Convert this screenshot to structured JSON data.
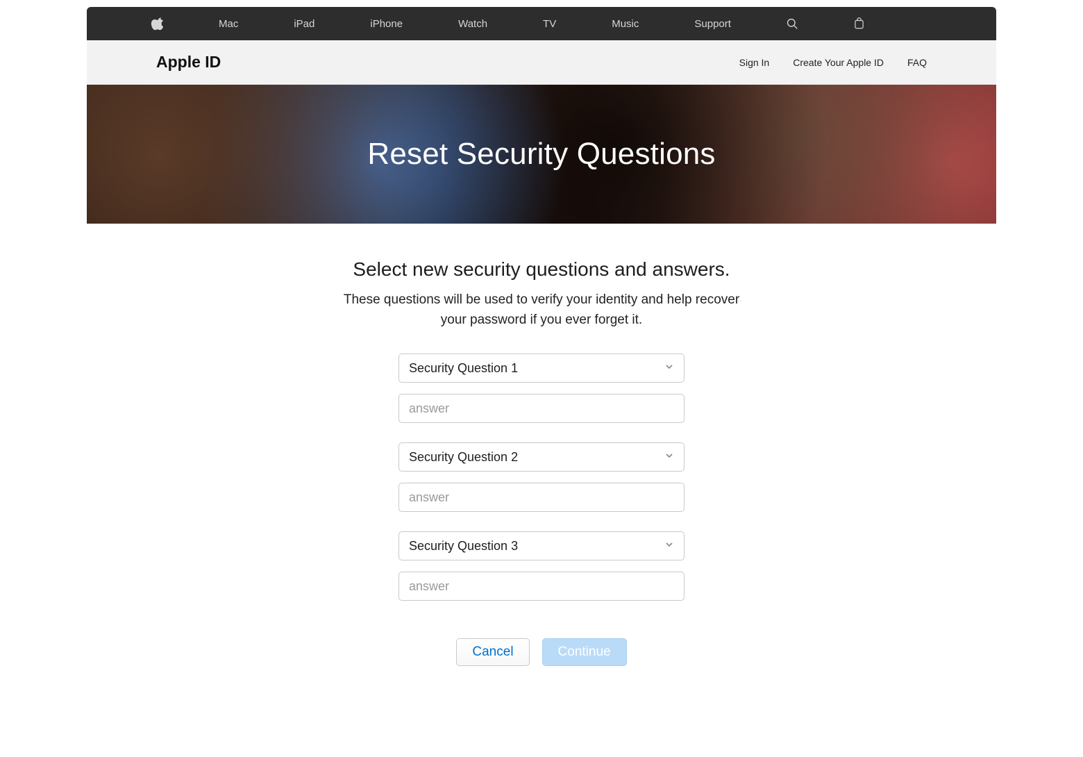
{
  "global_nav": {
    "items": [
      "Mac",
      "iPad",
      "iPhone",
      "Watch",
      "TV",
      "Music",
      "Support"
    ]
  },
  "sub_nav": {
    "title": "Apple ID",
    "links": [
      "Sign In",
      "Create Your Apple ID",
      "FAQ"
    ]
  },
  "hero": {
    "title": "Reset Security Questions"
  },
  "content": {
    "heading": "Select new security questions and answers.",
    "subtext": "These questions will be used to verify your identity and help recover your password if you ever forget it."
  },
  "form": {
    "questions": [
      {
        "select_label": "Security Question 1",
        "answer_placeholder": "answer"
      },
      {
        "select_label": "Security Question 2",
        "answer_placeholder": "answer"
      },
      {
        "select_label": "Security Question 3",
        "answer_placeholder": "answer"
      }
    ]
  },
  "buttons": {
    "cancel": "Cancel",
    "continue": "Continue"
  }
}
